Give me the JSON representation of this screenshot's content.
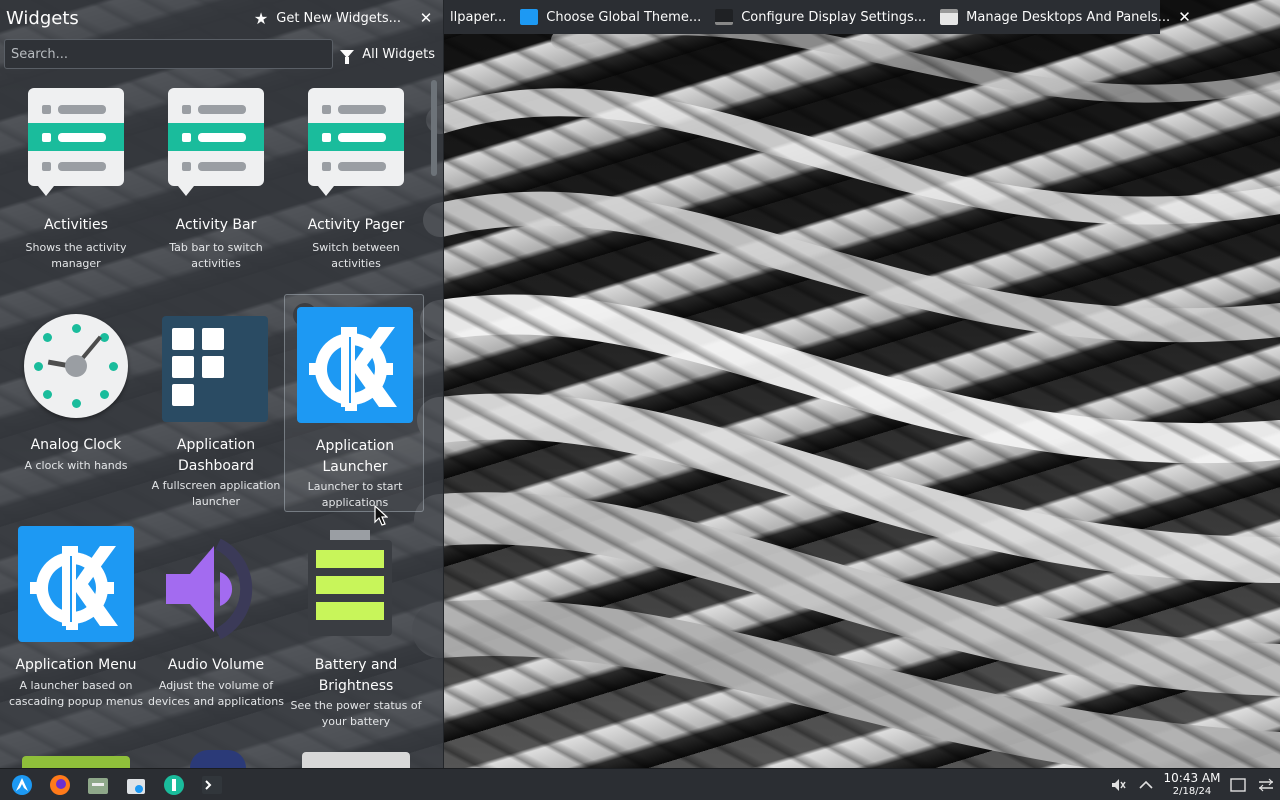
{
  "panel": {
    "tasks": [
      {
        "label": "llpaper...",
        "icon": "wallpaper-icon",
        "color": "#4a4f55"
      },
      {
        "label": "Choose Global Theme...",
        "icon": "global-theme-icon",
        "color": "#1d99f3"
      },
      {
        "label": "Configure Display Settings...",
        "icon": "display-icon",
        "color": "#444"
      },
      {
        "label": "Manage Desktops And Panels...",
        "icon": "desktops-panels-icon",
        "color": "#ddd"
      }
    ],
    "close": "✕"
  },
  "widgets": {
    "title": "Widgets",
    "get_new": "Get New Widgets...",
    "close": "✕",
    "search_placeholder": "Search...",
    "filter_label": "All Widgets",
    "items": [
      {
        "name": "Activities",
        "desc": "Shows the activity manager"
      },
      {
        "name": "Activity Bar",
        "desc": "Tab bar to switch activities"
      },
      {
        "name": "Activity Pager",
        "desc": "Switch between activities"
      },
      {
        "name": "Analog Clock",
        "desc": "A clock with hands"
      },
      {
        "name": "Application Dashboard",
        "desc": "A fullscreen application launcher"
      },
      {
        "name": "Application Launcher",
        "desc": "Launcher to start applications",
        "badge": "1"
      },
      {
        "name": "Application Menu",
        "desc": "A launcher based on cascading popup menus"
      },
      {
        "name": "Audio Volume",
        "desc": "Adjust the volume of devices and applications"
      },
      {
        "name": "Battery and Brightness",
        "desc": "See the power status of your battery"
      }
    ]
  },
  "taskbar": {
    "time": "10:43 AM",
    "date": "2/18/24"
  },
  "colors": {
    "accent": "#1d99f3",
    "teal": "#1abc9c",
    "battery": "#c8f55a"
  }
}
